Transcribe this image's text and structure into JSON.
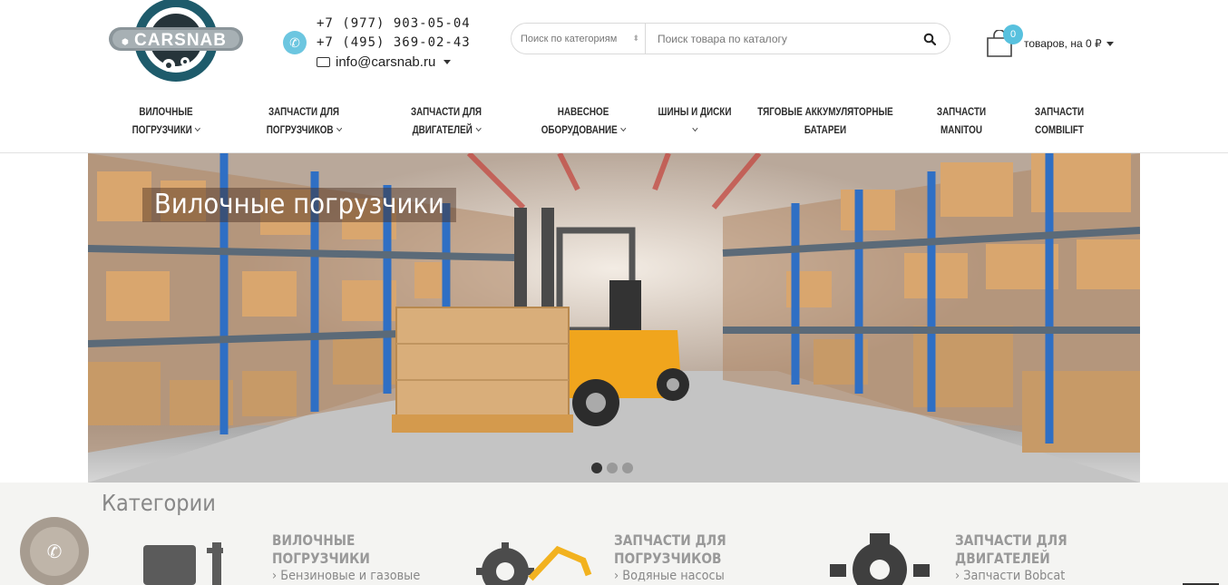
{
  "brand": {
    "logo_text": "CARSNAB"
  },
  "contacts": {
    "phone_1": "+7 (977) 903-05-04",
    "phone_2": "+7 (495) 369-02-43",
    "email": "info@carsnab.ru"
  },
  "search": {
    "category_placeholder": "Поиск по категориям",
    "placeholder": "Поиск товара по каталогу"
  },
  "cart": {
    "count": "0",
    "summary": "товаров, на 0 ₽"
  },
  "nav": {
    "items": [
      {
        "line1": "Вилочные",
        "line2": "погрузчики",
        "has_dropdown": true
      },
      {
        "line1": "Запчасти для",
        "line2": "погрузчиков",
        "has_dropdown": true
      },
      {
        "line1": "Запчасти для",
        "line2": "двигателей",
        "has_dropdown": true
      },
      {
        "line1": "Навесное",
        "line2": "оборудование",
        "has_dropdown": true
      },
      {
        "line1": "Шины и диски",
        "line2": "",
        "has_dropdown": true
      },
      {
        "line1": "Тяговые аккумуляторные",
        "line2": "батареи",
        "has_dropdown": false
      },
      {
        "line1": "Запчасти",
        "line2": "Manitou",
        "has_dropdown": false
      },
      {
        "line1": "Запчасти",
        "line2": "Combilift",
        "has_dropdown": false
      }
    ]
  },
  "banner": {
    "caption": "Вилочные погрузчики",
    "slide_count": 3,
    "active_slide": 1
  },
  "categories": {
    "title": "Категории",
    "items": [
      {
        "name_line1": "Вилочные",
        "name_line2": "погрузчики",
        "first_sub": "Бензиновые и газовые"
      },
      {
        "name_line1": "Запчасти для",
        "name_line2": "погрузчиков",
        "first_sub": "Водяные насосы"
      },
      {
        "name_line1": "Запчасти для",
        "name_line2": "двигателей",
        "first_sub": "Запчасти Bobcat"
      }
    ]
  },
  "colors": {
    "accent": "#58c1de",
    "nav_text": "#2b2b2b",
    "rack_blue": "#2f6fc4",
    "forklift_yellow": "#f0a51d"
  }
}
